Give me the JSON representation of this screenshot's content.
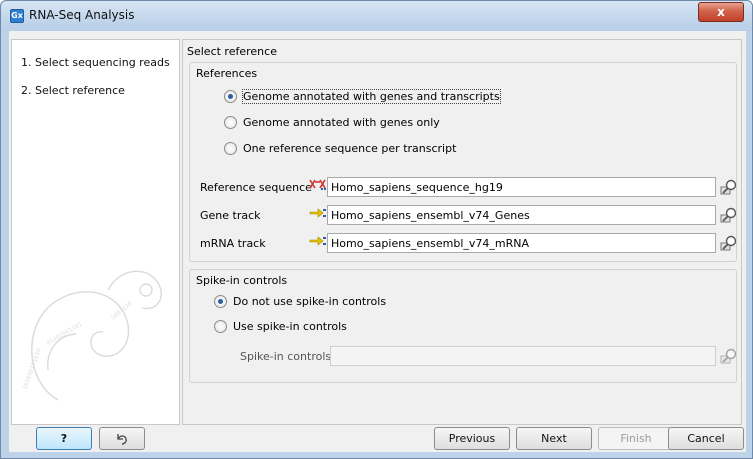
{
  "window": {
    "app_icon_text": "Gx",
    "title": "RNA-Seq Analysis",
    "close_symbol": "x"
  },
  "steps": [
    {
      "label": "1.  Select sequencing reads"
    },
    {
      "label": "2.  Select reference"
    }
  ],
  "page_title": "Select reference",
  "references": {
    "title": "References",
    "options": [
      {
        "label": "Genome annotated with genes and transcripts",
        "checked": true
      },
      {
        "label": "Genome annotated with genes only",
        "checked": false
      },
      {
        "label": "One reference sequence per transcript",
        "checked": false
      }
    ],
    "fields": [
      {
        "label": "Reference sequence",
        "value": "Homo_sapiens_sequence_hg19",
        "icon": "sequence-icon"
      },
      {
        "label": "Gene track",
        "value": "Homo_sapiens_ensembl_v74_Genes",
        "icon": "track-icon"
      },
      {
        "label": "mRNA track",
        "value": "Homo_sapiens_ensembl_v74_mRNA",
        "icon": "track-icon"
      }
    ]
  },
  "spike_in": {
    "title": "Spike-in controls",
    "options": [
      {
        "label": "Do not use spike-in controls",
        "checked": true
      },
      {
        "label": "Use spike-in controls",
        "checked": false
      }
    ],
    "field_label": "Spike-in controls",
    "field_value": ""
  },
  "buttons": {
    "help": "?",
    "reset_icon": "reset-icon",
    "previous": "Previous",
    "next": "Next",
    "finish": "Finish",
    "cancel": "Cancel"
  },
  "colors": {
    "accent": "#2b5fa3",
    "close_button": "#c1422a",
    "sequence_icon": "#d0302a",
    "track_icon": "#d8a800"
  }
}
